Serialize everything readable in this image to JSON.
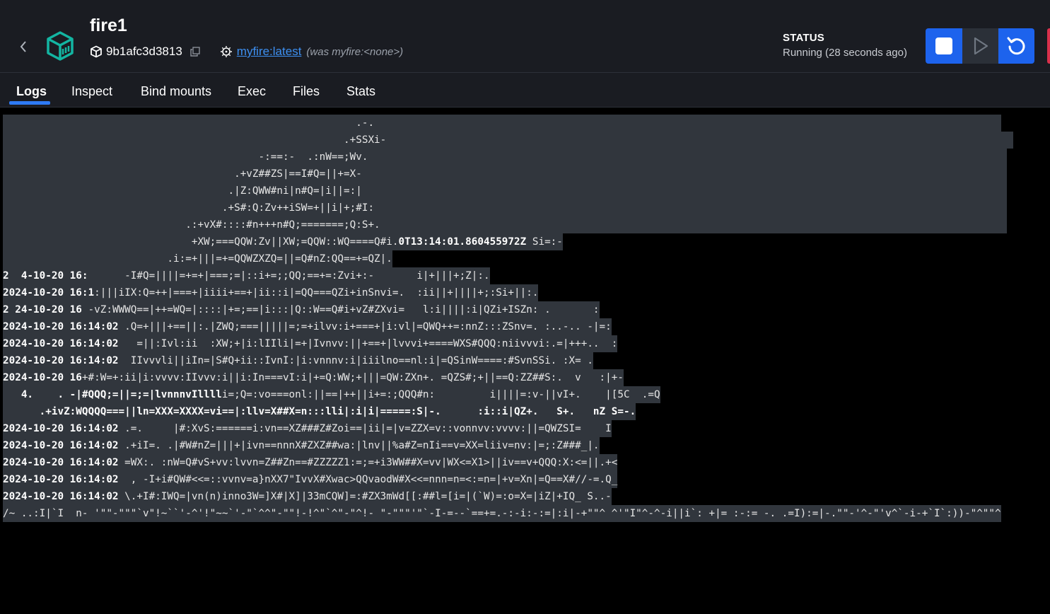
{
  "header": {
    "title": "fire1",
    "container_id": "9b1afc3d3813",
    "image_link": "myfire:latest",
    "image_previous": "(was myfire:<none>)",
    "status_label": "STATUS",
    "status_value": "Running (28 seconds ago)",
    "accent_color": "#1d63ed",
    "brand_color": "#13b5a2"
  },
  "tabs": [
    {
      "label": "Logs",
      "active": true
    },
    {
      "label": "Inspect",
      "active": false
    },
    {
      "label": "Bind mounts",
      "active": false
    },
    {
      "label": "Exec",
      "active": false
    },
    {
      "label": "Files",
      "active": false
    },
    {
      "label": "Stats",
      "active": false
    }
  ],
  "logs": [
    [
      "",
      "",
      "",
      "                                                          .-.                                                                                                       "
    ],
    [
      "",
      "",
      "",
      "                                                        .+SSXi-                                                                                                       "
    ],
    [
      "",
      "",
      "",
      "                                          -:==:-  .:nW==;Wv.                                                                                                         "
    ],
    [
      "",
      "",
      "",
      "                                      .+vZ##ZS|==I#Q=||+=X-                                                                                                          "
    ],
    [
      "",
      "",
      "",
      "                                     .|Z:QWW#ni|n#Q=|i||=:|                                                                                                          "
    ],
    [
      "",
      "",
      "",
      "                                    .+S#:Q:Zv++iSW=+||i|+;#I:                                                                                                        "
    ],
    [
      "",
      "",
      "",
      "                              .:+vX#::::#n+++n#Q;=======;Q:S+.                                                                                                       "
    ],
    [
      "",
      "",
      "",
      "                               +XW;===QQW:Zv||XW;=QQW::WQ====Q#i.",
      "0T13:14:01.860455972Z",
      " Si=:-"
    ],
    [
      "",
      "",
      "",
      "                           .i:=+|||=+=QQWZXZQ=||=Q#nZ:QQ==+=QZ|."
    ],
    [
      "2  4-10-20 16:",
      "",
      "",
      "      -I#Q=||||=+=+|===;=|::i+=;;QQ;==+=:Zvi+:-       i|+|||+;Z|:."
    ],
    [
      "2024-10-20 16:1",
      "",
      "",
      ":|||iIX:Q=++|===+|iiii+==+|ii::i|=QQ===QZi+inSnvi=.  :ii||+||||+;:Si+||:."
    ],
    [
      "2 24-10-20 16",
      "",
      "",
      " -vZ:WWWQ==|++=WQ=|::::|+=;==|i:::|Q::W==Q#i+vZ#ZXvi=   l:i||||:i|QZi+ISZn: .       :"
    ],
    [
      "2024-10-20 16:14:02",
      "",
      "",
      " .Q=+|||+==||:.|ZWQ;===|||||=;=+ilvv:i+===+|i:vl|=QWQ++=:nnZ:::ZSnv=. :..-.. -|=:"
    ],
    [
      "2024-10-20 16:14:02",
      "",
      "",
      "   =||:Ivl:ii  :XW;+|i:lIIli|=+|Ivnvv:||+==+|lvvvi+====WXS#QQQ:niivvvi:.=|+++..  :"
    ],
    [
      "2024-10-20 16:14:02",
      "",
      "",
      "  IIvvvli||iIn=|S#Q+ii::IvnI:|i:vnnnv:i|iiilno==nl:i|=QSinW====:#SvnSSi. :X= ."
    ],
    [
      "2024-10-20 16",
      "",
      "",
      "+#:W=+:ii|i:vvvv:IIvvv:i||i:In===vI:i|+=Q:WW;+|||=QW:ZXn+. =QZS#;+||==Q:ZZ##S:.  v   :|+-"
    ],
    [
      "   4.    . -|#QQQ;=||=;=|lvnnnvIllll",
      "",
      "",
      "i=;Q=:vo===onl:||==|++||i+=:;QQQ#n:         i||||=:v-||vI+.    |[5C  .=Q"
    ],
    [
      "      .+ivZ:WQQQQ===||ln=XXX=XXXX=vi==|:llv=X##X=n:::lli|:i|i|=====:S|-.      :i::i|QZ+.   S+.   nZ S=-."
    ],
    [
      "2024-10-20 16:14:02",
      "",
      "",
      " .=.     |#:XvS:======i:vn==XZ###Z#Zoi==|ii|=|v=ZZX=v::vonnvv:vvvv:||=QWZSI=    I"
    ],
    [
      "2024-10-20 16:14:02",
      "",
      "",
      " .+iI=. .|#W#nZ=|||+|ivn==nnnX#ZXZ##wa:|lnv||%a#Z=nIi==v=XX=liiv=nv:|=;:Z###_|."
    ],
    [
      "2024-10-20 16:14:02",
      "",
      "",
      " =WX:. :nW=Q#vS+vv:lvvn=Z##Zn==#ZZZZZ1:=;=+i3WW##X=vv|WX<=X1>||iv==v+QQQ:X:<=||.+<"
    ],
    [
      "2024-10-20 16:14:02",
      "",
      "",
      "  , -I+i#QW#<<=::vvnv=a}nXX7\"IvvX#Xwac>QQvaodW#X<<=nnn=n=<:=n=|+v=Xn|=Q==X#//-=.Q_"
    ],
    [
      "2024-10-20 16:14:02",
      "",
      "",
      " \\.+I#:IWQ=|vn(n)inno3W=]X#|X]|33mCQW]=:#ZX3mWd[[:##l=[i=|(`W)=:o=X=|iZ|+IQ_ S..-"
    ],
    [
      "",
      "",
      "",
      "/~ ..:I|`I  n- '\"\"-\"\"\"`v\"!~``'-^'!\"~~`'-\"`^^\"-\"\"!-!^\"`^\"-\"^!- \"-\"\"\"'\"`-I-=--`==+=.-:-i:-:=|:i|-+\"\"^ ^'\"I\"^-^-i||i`: +|= :-:= -. .=I):=|-.\"\"-'^-\"'v^`-i-+`I`:))-\"^\"\"^"
    ]
  ]
}
